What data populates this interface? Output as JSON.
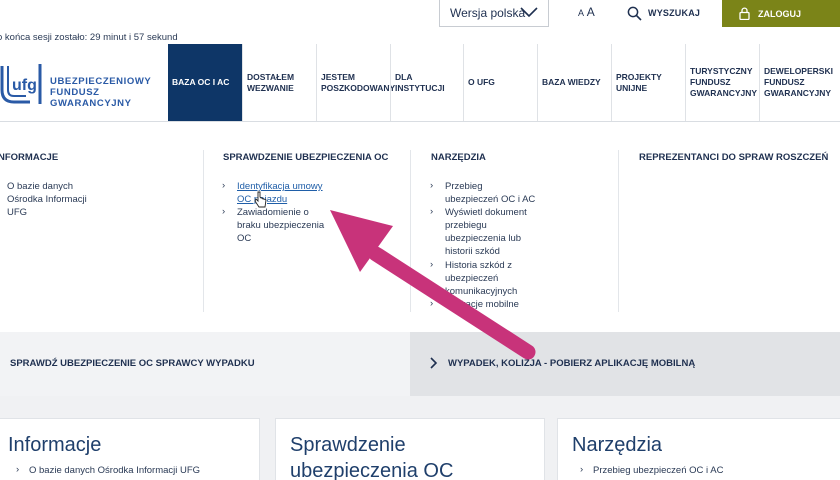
{
  "topbar": {
    "language_select": "Wersja polska",
    "font_size_small": "A",
    "font_size_large": "A",
    "search_label": "WYSZUKAJ",
    "login_label": "ZALOGUJ"
  },
  "session": {
    "text": "o końca sesji zostało: 29 minut i 57 sekund"
  },
  "logo": {
    "line1": "UBEZPIECZENIOWY",
    "line2": "FUNDUSZ",
    "line3": "GWARANCYJNY",
    "mark": "ufg"
  },
  "nav": [
    {
      "label": "BAZA OC I AC",
      "active": true
    },
    {
      "label": "DOSTAŁEM WEZWANIE"
    },
    {
      "label": "JESTEM POSZKODOWANY"
    },
    {
      "label": "DLA INSTYTUCJI"
    },
    {
      "label": "O UFG"
    },
    {
      "label": "BAZA WIEDZY"
    },
    {
      "label": "PROJEKTY UNIJNE"
    },
    {
      "label": "TURYSTYCZNY FUNDUSZ GWARANCYJNY"
    },
    {
      "label": "DEWELOPERSKI FUNDUSZ GWARANCYJNY"
    }
  ],
  "mega": {
    "col1": {
      "title": "NFORMACJE",
      "links": [
        "O bazie danych",
        "Ośrodka Informacji",
        "UFG"
      ]
    },
    "col2": {
      "title": "SPRAWDZENIE UBEZPIECZENIA OC",
      "link1": [
        "Identyfikacja umowy",
        "OC pojazdu"
      ],
      "link2": [
        "Zawiadomienie o",
        "braku ubezpieczenia",
        "OC"
      ]
    },
    "col3": {
      "title": "NARZĘDZIA",
      "link1": [
        "Przebieg",
        "ubezpieczeń OC i AC"
      ],
      "link2": [
        "Wyświetl dokument",
        "przebiegu",
        "ubezpieczenia lub",
        "historii szkód"
      ],
      "link3": [
        "Historia szkód z",
        "ubezpieczeń",
        "komunikacyjnych"
      ],
      "link4": [
        "Aplikacje mobilne"
      ]
    },
    "col4": {
      "title": "REPREZENTANCI DO SPRAW ROSZCZEŃ"
    }
  },
  "banners": {
    "left": "SPRAWDŹ UBEZPIECZENIE OC SPRAWCY WYPADKU",
    "right": "WYPADEK, KOLIZJA - POBIERZ APLIKACJĘ MOBILNĄ"
  },
  "cards": [
    {
      "title": "Informacje",
      "link": "O bazie danych Ośrodka Informacji UFG"
    },
    {
      "title": "Sprawdzenie",
      "title2": "ubezpieczenia OC"
    },
    {
      "title": "Narzędzia",
      "link": "Przebieg ubezpieczeń OC i AC"
    }
  ],
  "colors": {
    "navy": "#0e3667",
    "login_green": "#7b8418",
    "annotation": "#c8337a"
  }
}
